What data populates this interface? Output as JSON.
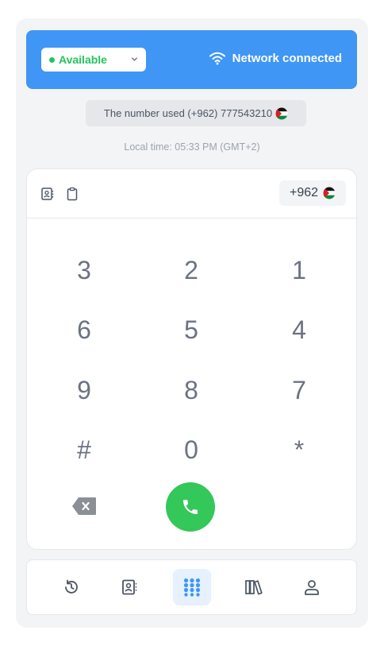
{
  "status": {
    "label": "Available",
    "color": "#22c55e"
  },
  "network": {
    "label": "Network connected"
  },
  "number_used": {
    "text": "The number used (+962) 777543210"
  },
  "local_time": {
    "text": "Local time: 05:33 PM  (GMT+2)"
  },
  "country_code": {
    "label": "+962"
  },
  "keypad": {
    "keys": [
      "3",
      "2",
      "1",
      "6",
      "5",
      "4",
      "9",
      "8",
      "7",
      "#",
      "0",
      "*"
    ]
  },
  "nav": {
    "items": [
      "history-icon",
      "contacts-icon",
      "keypad-icon",
      "library-icon",
      "profile-icon"
    ],
    "active": "keypad-icon"
  },
  "colors": {
    "accent": "#3f96f5",
    "call": "#34c759",
    "available": "#22c55e"
  }
}
